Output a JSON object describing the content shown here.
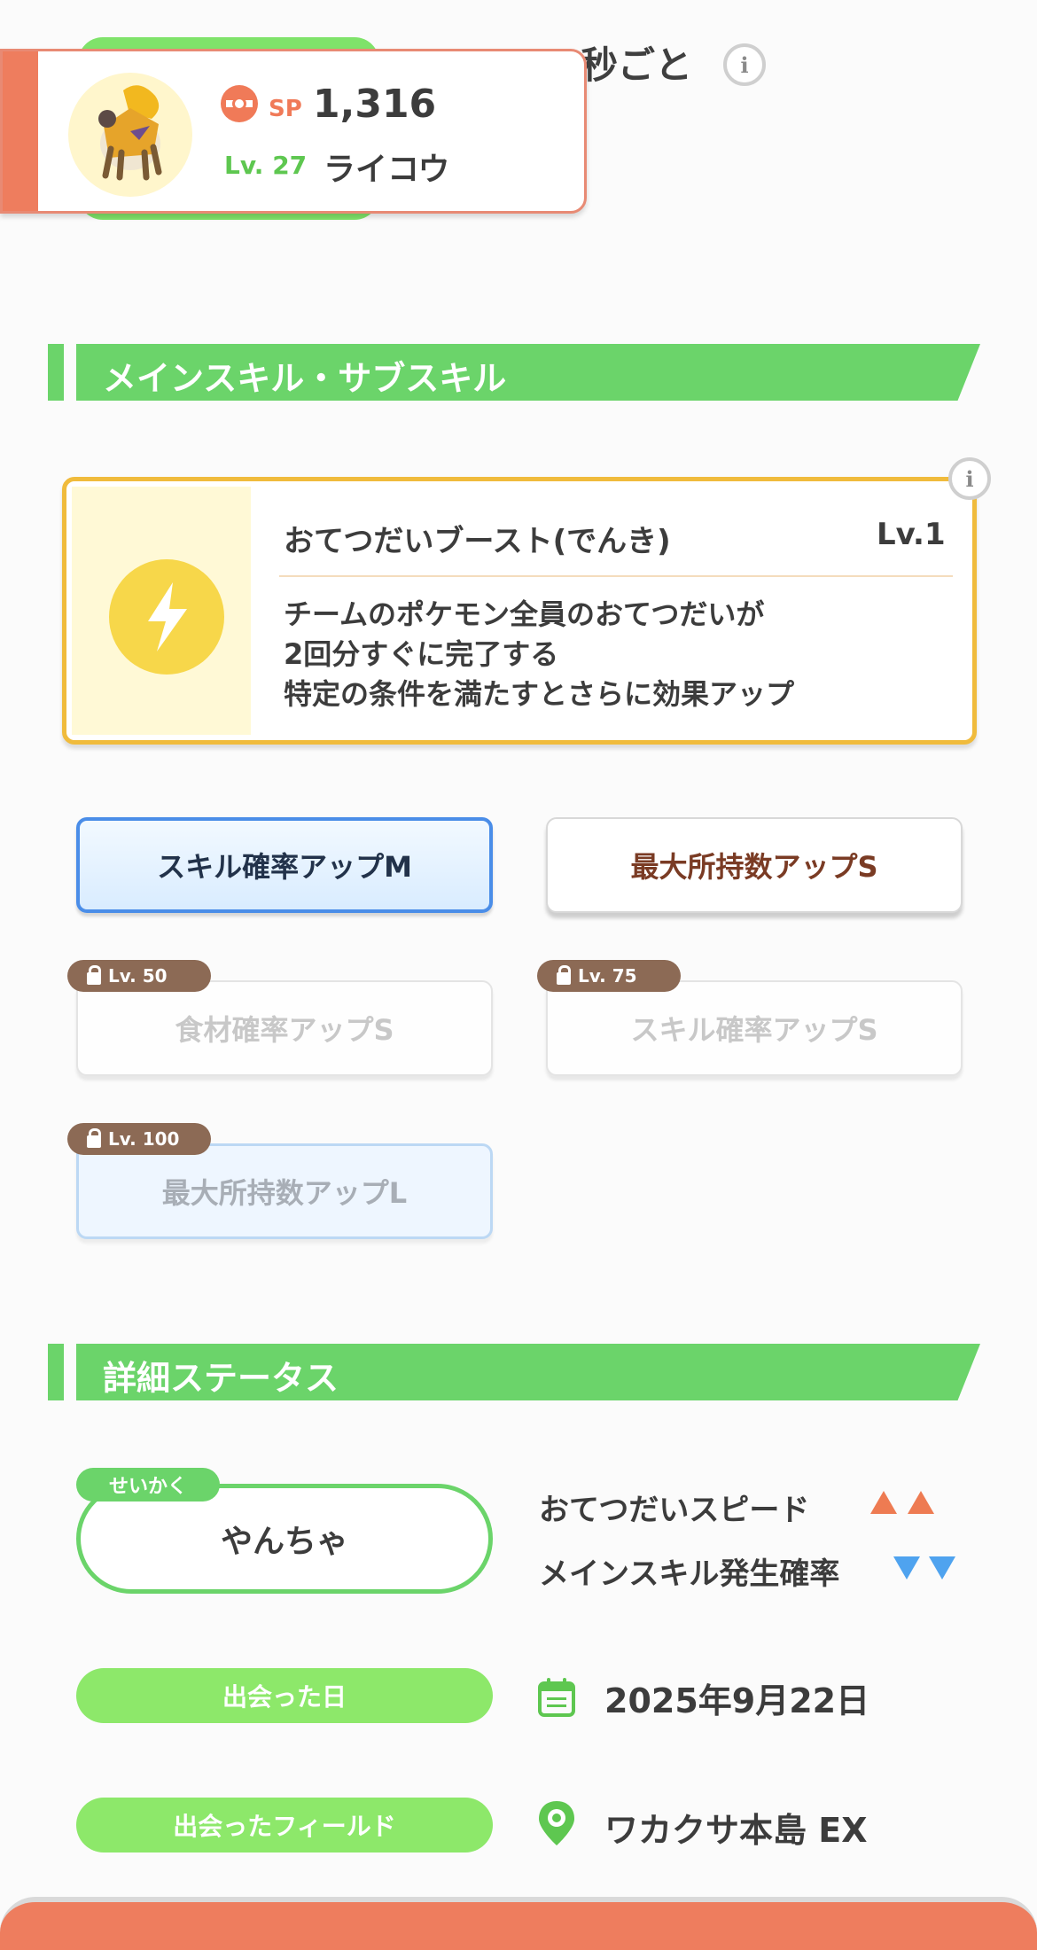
{
  "header": {
    "top_text": "秒ごと"
  },
  "pokemon": {
    "sp_label": "SP",
    "sp_value": "1,316",
    "level": "Lv. 27",
    "name": "ライコウ"
  },
  "sections": {
    "skills_title": "メインスキル・サブスキル",
    "status_title": "詳細ステータス"
  },
  "main_skill": {
    "name": "おてつだいブースト(でんき)",
    "level": "Lv.1",
    "desc_line1": "チームのポケモン全員のおてつだいが",
    "desc_line2": "2回分すぐに完了する",
    "desc_line3": "特定の条件を満たすとさらに効果アップ"
  },
  "sub_skills": [
    {
      "label": "スキル確率アップM",
      "lock": ""
    },
    {
      "label": "最大所持数アップS",
      "lock": ""
    },
    {
      "label": "食材確率アップS",
      "lock": "Lv. 50"
    },
    {
      "label": "スキル確率アップS",
      "lock": "Lv. 75"
    },
    {
      "label": "最大所持数アップL",
      "lock": "Lv. 100"
    }
  ],
  "nature": {
    "tag": "せいかく",
    "value": "やんちゃ",
    "up_stat": "おてつだいスピード",
    "down_stat": "メインスキル発生確率"
  },
  "met_date": {
    "label": "出会った日",
    "value": "2025年9月22日"
  },
  "met_field": {
    "label": "出会ったフィールド",
    "value": "ワカクサ本島 EX"
  },
  "colors": {
    "accent_green": "#6bd46a",
    "sp_orange": "#f07a58",
    "up_arrow": "#ee7b52",
    "down_arrow": "#4fa3ef"
  }
}
